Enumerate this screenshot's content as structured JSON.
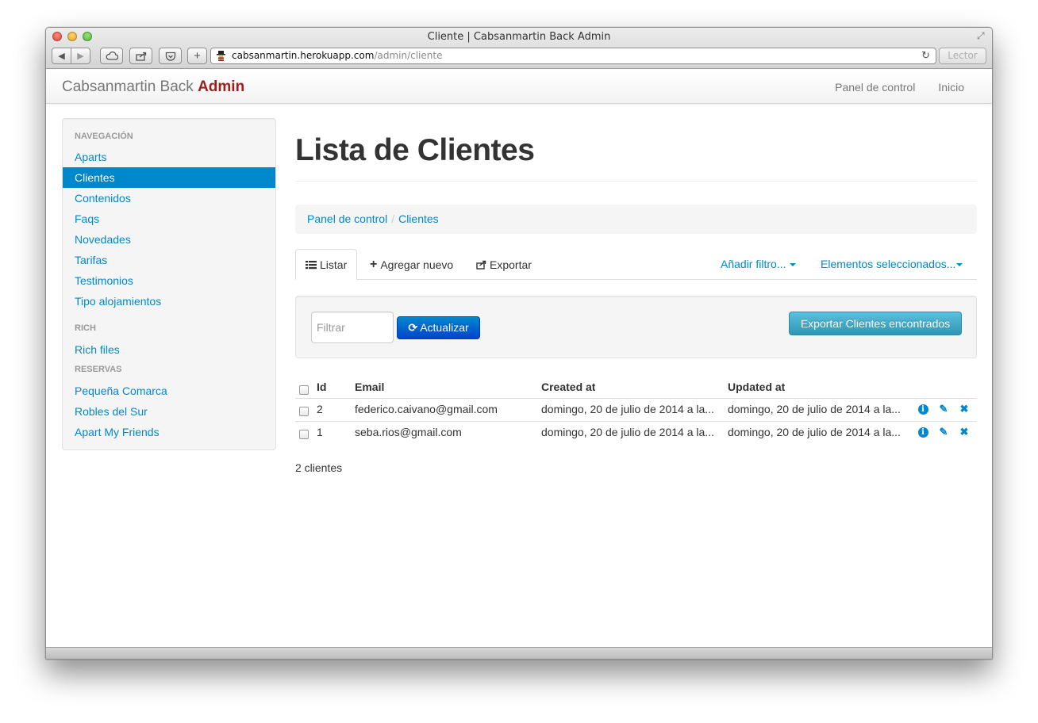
{
  "window": {
    "title": "Cliente | Cabsanmartin Back Admin",
    "url_host": "cabsanmartin.herokuapp.com",
    "url_path": "/admin/cliente",
    "reader_label": "Lector"
  },
  "navbar": {
    "brand": "Cabsanmartin Back",
    "brand_accent": "Admin",
    "links": [
      "Panel de control",
      "Inicio"
    ]
  },
  "sidebar": {
    "sections": [
      {
        "header": "NAVEGACIÓN",
        "items": [
          "Aparts",
          "Clientes",
          "Contenidos",
          "Faqs",
          "Novedades",
          "Tarifas",
          "Testimonios",
          "Tipo alojamientos"
        ]
      },
      {
        "header": "RICH",
        "items": [
          "Rich files"
        ]
      },
      {
        "header": "RESERVAS",
        "items": [
          "Pequeña Comarca",
          "Robles del Sur",
          "Apart My Friends"
        ]
      }
    ],
    "active_item": "Clientes"
  },
  "main": {
    "title": "Lista de Clientes",
    "breadcrumb": [
      "Panel de control",
      "Clientes"
    ],
    "tabs": [
      "Listar",
      "Agregar nuevo",
      "Exportar"
    ],
    "tab_menus": [
      "Añadir filtro...",
      "Elementos seleccionados..."
    ],
    "filter_placeholder": "Filtrar",
    "update_button": "Actualizar",
    "export_button": "Exportar Clientes encontrados",
    "table": {
      "columns": [
        "Id",
        "Email",
        "Created at",
        "Updated at"
      ],
      "rows": [
        {
          "id": "2",
          "email": "federico.caivano@gmail.com",
          "created": "domingo, 20 de julio de 2014 a la...",
          "updated": "domingo, 20 de julio de 2014 a la..."
        },
        {
          "id": "1",
          "email": "seba.rios@gmail.com",
          "created": "domingo, 20 de julio de 2014 a la...",
          "updated": "domingo, 20 de julio de 2014 a la..."
        }
      ]
    },
    "count_text": "2 clientes"
  },
  "colors": {
    "link": "#0088cc",
    "brand_accent": "#9b1f1f",
    "primary_button": "#0044cc",
    "info_button": "#5bc0de"
  }
}
